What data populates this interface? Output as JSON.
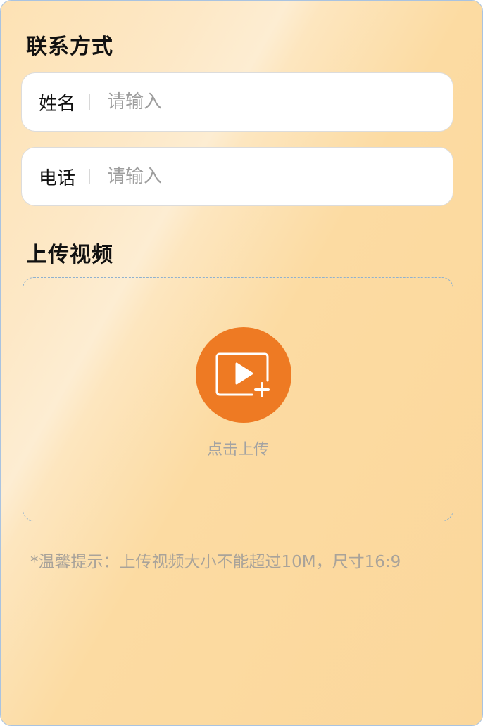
{
  "contact": {
    "title": "联系方式",
    "name_label": "姓名",
    "name_placeholder": "请输入",
    "phone_label": "电话",
    "phone_placeholder": "请输入"
  },
  "upload": {
    "title": "上传视频",
    "button_label": "点击上传",
    "icon": "video-add-icon",
    "hint": "*温馨提示：上传视频大小不能超过10M，尺寸16:9"
  },
  "colors": {
    "accent": "#ee7a23",
    "background": "#fbd79b"
  }
}
